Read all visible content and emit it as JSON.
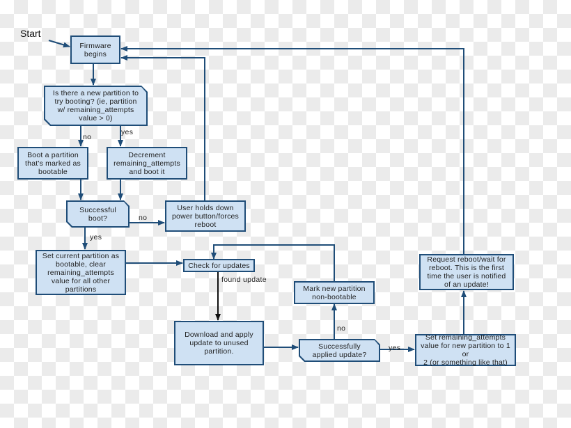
{
  "start_label": "Start",
  "nodes": {
    "firmware": "Firmware\nbegins",
    "new_partition_q": "Is there a new partition to\ntry booting? (ie, partition\nw/ remaining_attempts\nvalue > 0)",
    "boot_bootable": "Boot a partition\nthat's marked as\nbootable",
    "decrement": "Decrement\nremaining_attempts\nand boot it",
    "successful_boot_q": "Successful\nboot?",
    "user_reboot": "User holds down\npower button/forces\nreboot",
    "set_current": "Set current partition as\nbootable, clear\nremaining_attempts\nvalue for all other\npartitions",
    "check_updates": "Check for updates",
    "download_apply": "Download and apply\nupdate to unused\npartition.",
    "applied_q": "Successfully\napplied update?",
    "mark_non_bootable": "Mark new partition\nnon-bootable",
    "set_remaining": "Set remaining_attempts\nvalue for new partition to 1 or\n2 (or something like that)",
    "request_reboot": "Request reboot/wait for\nreboot. This is the first\ntime the user is notified\nof an update!"
  },
  "edge_labels": {
    "no_1": "no",
    "yes_1": "yes",
    "no_2": "no",
    "yes_2": "yes",
    "found_update": "found update",
    "no_3": "no",
    "yes_3": "yes"
  },
  "colors": {
    "box_fill": "#cfe1f3",
    "box_border": "#1f4d78",
    "edge": "#1f4d78",
    "edge_dark": "#111111"
  }
}
